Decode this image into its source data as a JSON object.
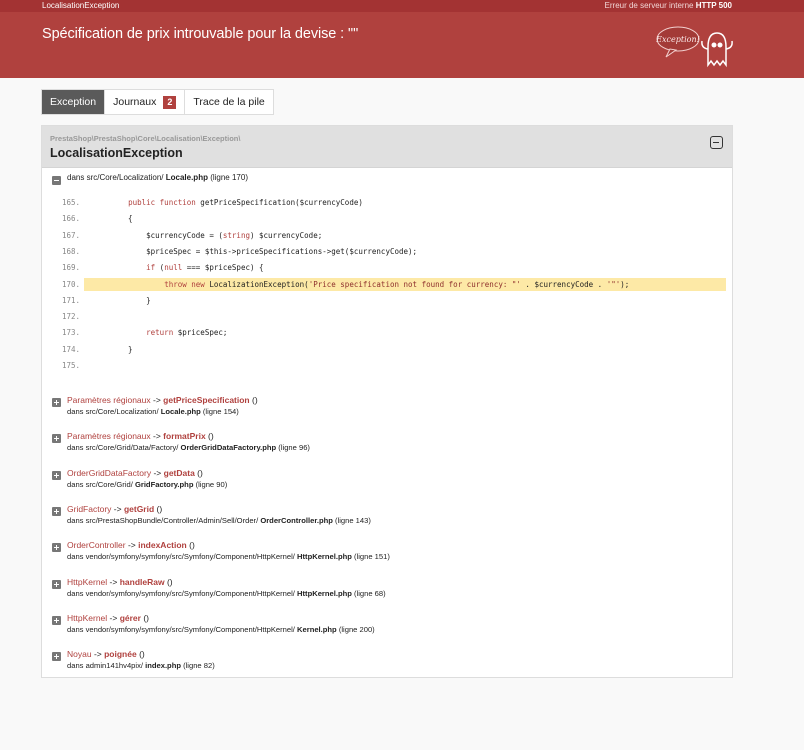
{
  "topbar": {
    "exception_name": "LocalisationException",
    "status_prefix": "Erreur de serveur interne ",
    "status_code": "HTTP 500"
  },
  "header": {
    "title": "Spécification de prix introuvable pour la devise : \"\"",
    "mascot_text": "Exception!"
  },
  "tabs": [
    {
      "label": "Exception",
      "active": true
    },
    {
      "label": "Journaux",
      "badge": "2",
      "active": false
    },
    {
      "label": "Trace de la pile",
      "active": false
    }
  ],
  "exception": {
    "namespace": "PrestaShop\\PrestaShop\\Core\\Localisation\\Exception\\",
    "class": "LocalisationException",
    "location_prefix": "dans src/Core/Localization/",
    "location_file": "Locale.php",
    "location_suffix": " (ligne 170)"
  },
  "code_lines": [
    {
      "n": "165.",
      "text": "    public function getPriceSpecification($currencyCode)"
    },
    {
      "n": "166.",
      "text": "    {"
    },
    {
      "n": "167.",
      "text": "        $currencyCode = (string) $currencyCode;"
    },
    {
      "n": "168.",
      "text": "        $priceSpec = $this->priceSpecifications->get($currencyCode);"
    },
    {
      "n": "169.",
      "text": "        if (null === $priceSpec) {"
    },
    {
      "n": "170.",
      "text": "            throw new LocalizationException('Price specification not found for currency: \"' . $currencyCode . '\"');",
      "highlight": true
    },
    {
      "n": "171.",
      "text": "        }"
    },
    {
      "n": "172.",
      "text": ""
    },
    {
      "n": "173.",
      "text": "        return $priceSpec;"
    },
    {
      "n": "174.",
      "text": "    }"
    },
    {
      "n": "175.",
      "text": ""
    }
  ],
  "frames": [
    {
      "class": "Paramètres régionaux",
      "arrow": " -> ",
      "method": "getPriceSpecification",
      "args": " ()",
      "path": "dans src/Core/Localization/ ",
      "file": "Locale.php",
      "line": " (ligne 154)"
    },
    {
      "class": "Paramètres régionaux",
      "arrow": " -> ",
      "method": "formatPrix",
      "args": " ()",
      "path": "dans src/Core/Grid/Data/Factory/ ",
      "file": "OrderGridDataFactory.php",
      "line": " (ligne 96)"
    },
    {
      "class": "OrderGridDataFactory",
      "arrow": " -> ",
      "method": "getData",
      "args": " ()",
      "path": "dans src/Core/Grid/ ",
      "file": "GridFactory.php",
      "line": " (ligne 90)"
    },
    {
      "class": "GridFactory",
      "arrow": " -> ",
      "method": "getGrid",
      "args": " ()",
      "path": "dans src/PrestaShopBundle/Controller/Admin/Sell/Order/ ",
      "file": "OrderController.php",
      "line": " (ligne 143)"
    },
    {
      "class": "OrderController",
      "arrow": " -> ",
      "method": "indexAction",
      "args": " ()",
      "path": "dans vendor/symfony/symfony/src/Symfony/Component/HttpKernel/ ",
      "file": "HttpKernel.php",
      "line": " (ligne 151)"
    },
    {
      "class": "HttpKernel",
      "arrow": " -> ",
      "method": "handleRaw",
      "args": " ()",
      "path": "dans vendor/symfony/symfony/src/Symfony/Component/HttpKernel/ ",
      "file": "HttpKernel.php",
      "line": " (ligne 68)"
    },
    {
      "class": "HttpKernel",
      "arrow": " -> ",
      "method": "gérer",
      "args": " ()",
      "path": "dans vendor/symfony/symfony/src/Symfony/Component/HttpKernel/ ",
      "file": "Kernel.php",
      "line": " (ligne 200)"
    },
    {
      "class": "Noyau",
      "arrow": " -> ",
      "method": "poignée",
      "args": " ()",
      "path": "dans admin141hv4pix/ ",
      "file": "index.php",
      "line": " (ligne 82)"
    }
  ],
  "colors": {
    "header": "#b0413e",
    "topbar": "#a33333",
    "highlight": "#fde9a6",
    "accent": "#b0413e"
  }
}
